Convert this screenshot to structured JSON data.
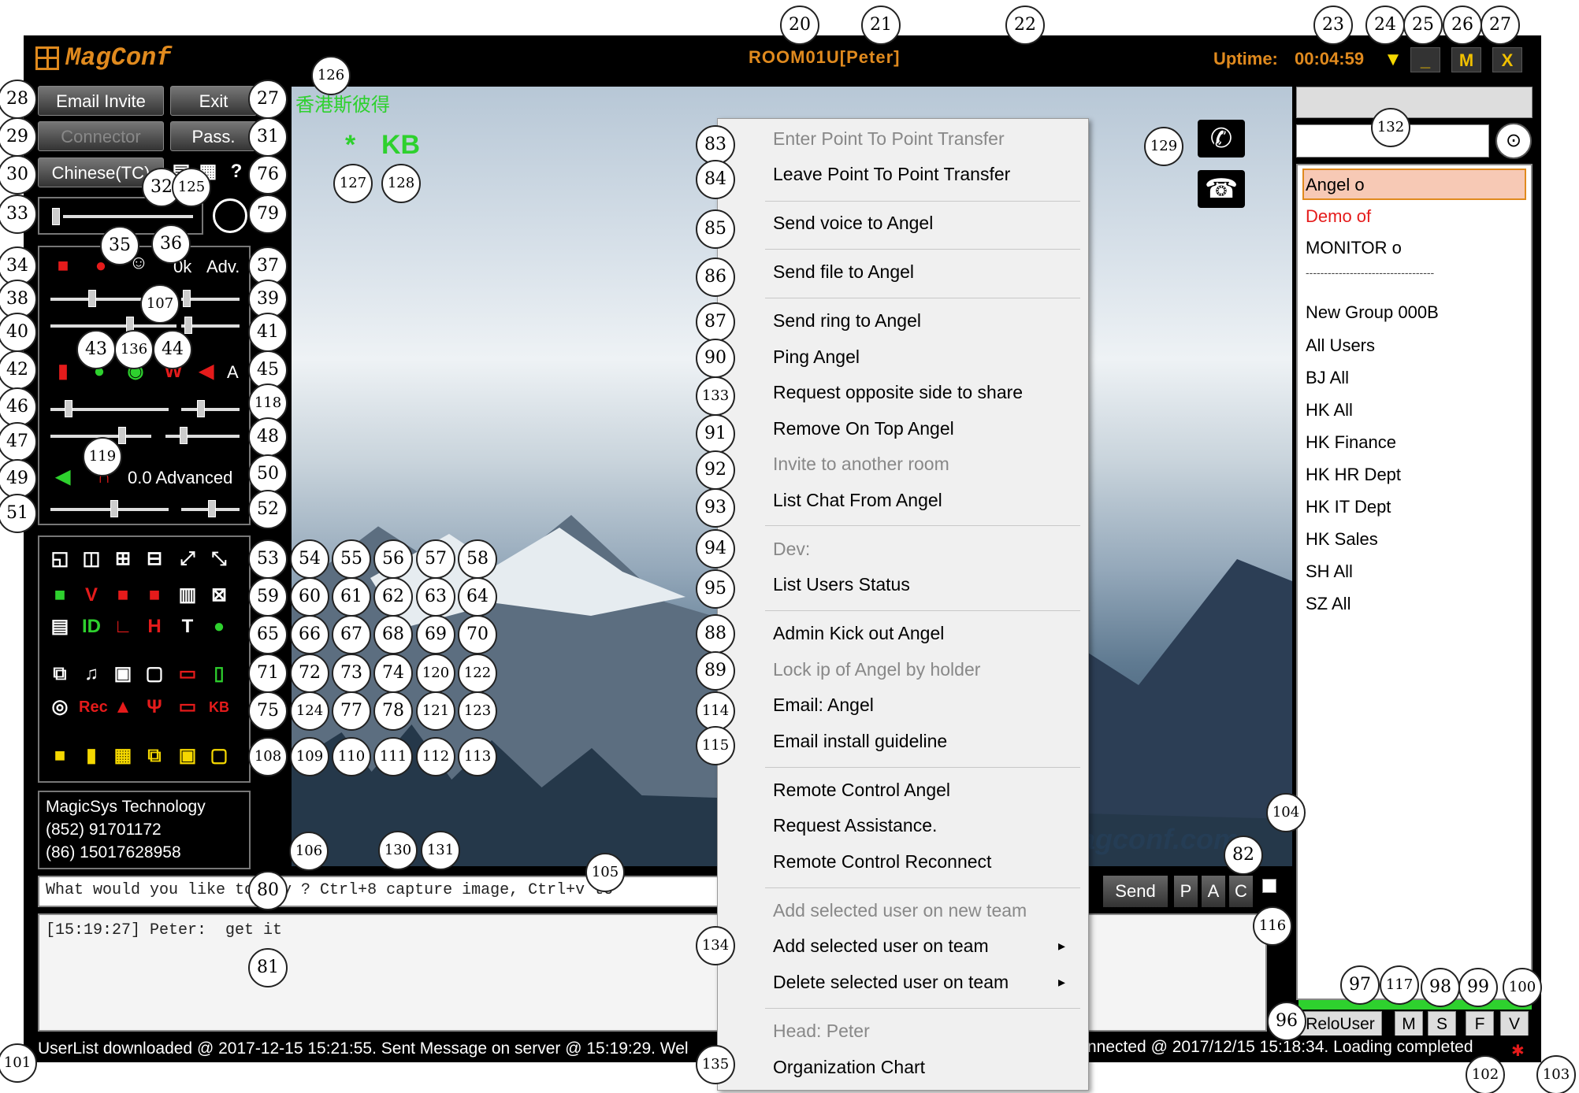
{
  "app": {
    "name": "MagConf",
    "room": "ROOM01U[Peter]",
    "uptime_label": "Uptime:",
    "uptime_value": "00:04:59"
  },
  "title_buttons": {
    "min": "_",
    "max": "M",
    "close": "X"
  },
  "left_buttons": {
    "email_invite": "Email Invite",
    "exit": "Exit",
    "connector": "Connector",
    "pass": "Pass.",
    "language": "Chinese(TC)"
  },
  "overlay": {
    "hk_text": "香港斯彼得",
    "kb": "KB",
    "asterisk": "*"
  },
  "audio": {
    "zero_k": "0k",
    "adv": "Adv.",
    "a": "A",
    "advanced": "0.0 Advanced"
  },
  "icon_grid": {
    "rec": "Rec",
    "id": "ID",
    "t": "T",
    "h": "H",
    "kb": "KB",
    "v": "V"
  },
  "company": {
    "name": "MagicSys Technology",
    "phone1": "(852) 91701172",
    "phone2": "(86) 15017628958"
  },
  "chat": {
    "input": "What would you like to say ? Ctrl+8 capture image, Ctrl+v to",
    "log": "[15:19:27] Peter:  get it",
    "send": "Send",
    "p": "P",
    "a": "A",
    "c": "C"
  },
  "status_bar": {
    "left": "UserList downloaded @ 2017-12-15 15:21:55. Sent Message on server @ 15:19:29. Wel",
    "right": "nnected @ 2017/12/15 15:18:34. Loading completed"
  },
  "watermark": "agconf.com",
  "users": {
    "items": [
      "Angel o",
      "Demo of",
      "MONITOR o"
    ],
    "groups": [
      "New Group 000B",
      "All Users",
      "BJ All",
      "HK All",
      "HK Finance",
      "HK HR Dept",
      "HK IT Dept",
      "HK Sales",
      "SH All",
      "SZ All"
    ],
    "separator": "-----------------------------------"
  },
  "bottom_right": {
    "relo": "ReloUser",
    "m": "M",
    "s": "S",
    "f": "F",
    "v": "V"
  },
  "menu": {
    "items": [
      {
        "label": "Enter Point To Point Transfer",
        "disabled": true
      },
      {
        "label": "Leave Point To Point Transfer",
        "disabled": false
      },
      {
        "label": "Send voice to Angel",
        "disabled": false
      },
      {
        "label": "Send file to Angel",
        "disabled": false
      },
      {
        "label": "Send ring to Angel",
        "disabled": false
      },
      {
        "label": "Ping Angel",
        "disabled": false
      },
      {
        "label": "Request opposite side to share",
        "disabled": false
      },
      {
        "label": "Remove On Top Angel",
        "disabled": false
      },
      {
        "label": "Invite to another room",
        "disabled": true
      },
      {
        "label": "List Chat From Angel",
        "disabled": false
      },
      {
        "label": "Dev:",
        "disabled": true
      },
      {
        "label": "List Users Status",
        "disabled": false
      },
      {
        "label": "Admin Kick out Angel",
        "disabled": false
      },
      {
        "label": "Lock ip of Angel by holder",
        "disabled": true
      },
      {
        "label": "Email: Angel",
        "disabled": false
      },
      {
        "label": "Email install guideline",
        "disabled": false
      },
      {
        "label": "Remote Control Angel",
        "disabled": false
      },
      {
        "label": "Request Assistance.",
        "disabled": false
      },
      {
        "label": "Remote Control Reconnect",
        "disabled": false
      },
      {
        "label": "Add selected user on new team",
        "disabled": true
      },
      {
        "label": "Add selected user on team",
        "disabled": false
      },
      {
        "label": "Delete selected user on team",
        "disabled": false
      },
      {
        "label": "Head: Peter",
        "disabled": true
      },
      {
        "label": "Organization Chart",
        "disabled": false
      }
    ],
    "submenu_arrow": "▸"
  },
  "callouts": [
    "20",
    "21",
    "22",
    "23",
    "24",
    "25",
    "26",
    "27",
    "28",
    "27",
    "29",
    "31",
    "30",
    "76",
    "32",
    "125",
    "33",
    "79",
    "35",
    "36",
    "34",
    "37",
    "38",
    "107",
    "39",
    "40",
    "41",
    "42",
    "43",
    "136",
    "44",
    "45",
    "46",
    "118",
    "47",
    "48",
    "119",
    "49",
    "50",
    "51",
    "52",
    "53",
    "54",
    "55",
    "56",
    "57",
    "58",
    "59",
    "60",
    "61",
    "62",
    "63",
    "64",
    "65",
    "66",
    "67",
    "68",
    "69",
    "70",
    "71",
    "72",
    "73",
    "74",
    "120",
    "122",
    "75",
    "124",
    "77",
    "78",
    "121",
    "123",
    "108",
    "109",
    "110",
    "111",
    "112",
    "113",
    "106",
    "130",
    "131",
    "105",
    "80",
    "81",
    "82",
    "116",
    "104",
    "126",
    "127",
    "128",
    "129",
    "132",
    "83",
    "84",
    "85",
    "86",
    "87",
    "90",
    "133",
    "91",
    "92",
    "93",
    "94",
    "95",
    "88",
    "89",
    "114",
    "115",
    "134",
    "135",
    "96",
    "97",
    "117",
    "98",
    "99",
    "100",
    "101",
    "102",
    "103"
  ],
  "colors": {
    "accent": "#e08a1e",
    "green": "#2ed12e",
    "red": "#e51b1b",
    "yellow": "#f5d800"
  }
}
